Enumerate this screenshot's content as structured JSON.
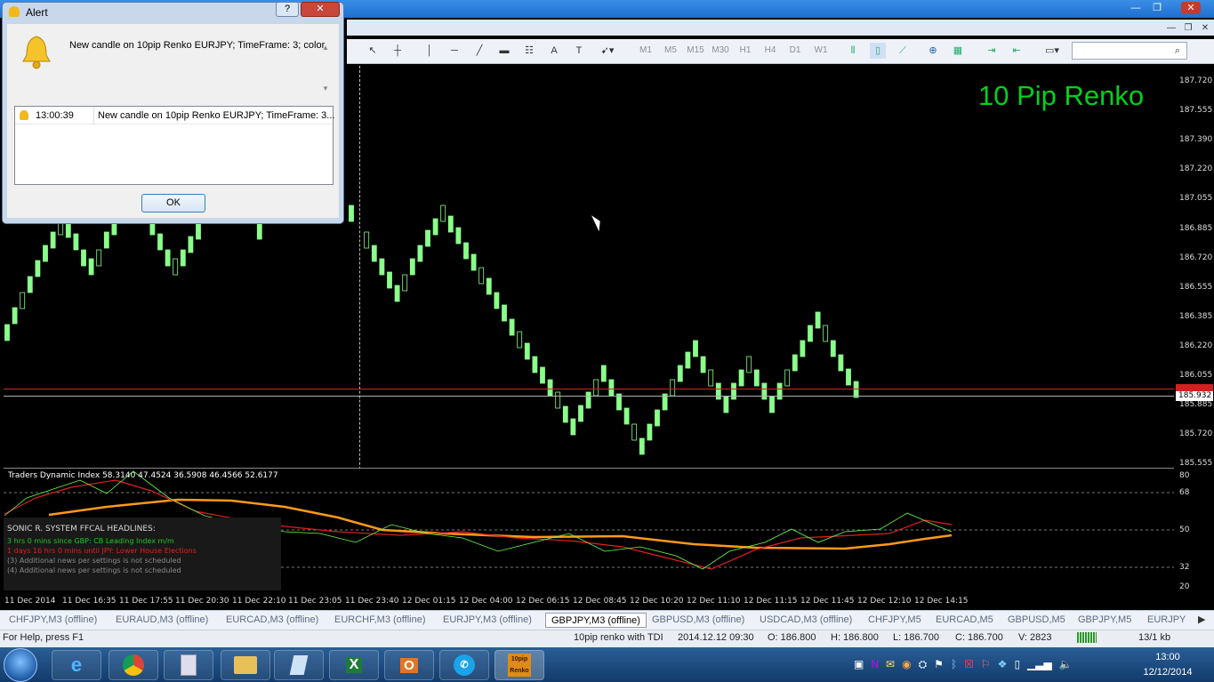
{
  "window": {
    "minimize": "—",
    "restore": "❐",
    "close": "✕"
  },
  "mdi": {
    "minimize": "—",
    "restore": "❐",
    "close": "✕"
  },
  "toolbar": {
    "timeframes": [
      "M1",
      "M5",
      "M15",
      "M30",
      "H1",
      "H4",
      "D1",
      "W1"
    ],
    "search_value": ""
  },
  "dialog": {
    "title": "Alert",
    "help_label": "?",
    "close_label": "✕",
    "message": "New candle on 10pip Renko EURJPY; TimeFrame: 3; color",
    "list": [
      {
        "time": "13:00:39",
        "text": "New candle on 10pip Renko EURJPY; TimeFrame: 3..."
      }
    ],
    "ok_label": "OK"
  },
  "chart": {
    "label": "10 Pip Renko",
    "price_labels": [
      "187.720",
      "187.555",
      "187.390",
      "187.220",
      "187.055",
      "186.885",
      "186.720",
      "186.555",
      "186.385",
      "186.220",
      "186.055",
      "185.885",
      "185.720",
      "185.555"
    ],
    "current_price": "185.932",
    "time_labels": [
      "11 Dec 2014",
      "11 Dec 16:35",
      "11 Dec 17:55",
      "11 Dec 20:30",
      "11 Dec 22:10",
      "11 Dec 23:05",
      "11 Dec 23:40",
      "12 Dec 01:15",
      "12 Dec 04:00",
      "12 Dec 06:15",
      "12 Dec 08:45",
      "12 Dec 10:20",
      "12 Dec 11:10",
      "12 Dec 11:15",
      "12 Dec 11:45",
      "12 Dec 12:10",
      "12 Dec 14:15"
    ],
    "bull_color": "#8aff8a"
  },
  "indicator": {
    "title": "Traders Dynamic Index 58.3140 47.4524 36.5908 46.4566 52.6177",
    "levels": [
      "80",
      "68",
      "50",
      "32",
      "20"
    ]
  },
  "news": {
    "header": "SONIC R. SYSTEM  FFCAL HEADLINES:",
    "lines": [
      {
        "text": "3 hrs 0 mins since GBP: CB Leading Index m/m",
        "color": "#22c422"
      },
      {
        "text": "1 days 16 hrs 0 mins until JPY: Lower House Elections",
        "color": "#e02020"
      },
      {
        "text": "(3)  Additional news per settings is not scheduled",
        "color": "#8a8a8a"
      },
      {
        "text": "(4)  Additional news per settings is not scheduled",
        "color": "#8a8a8a"
      }
    ]
  },
  "tabs": [
    "CHFJPY,M3 (offline)",
    "EURAUD,M3 (offline)",
    "EURCAD,M3 (offline)",
    "EURCHF,M3 (offline)",
    "EURJPY,M3 (offline)",
    "GBPJPY,M3 (offline)",
    "GBPUSD,M3 (offline)",
    "USDCAD,M3 (offline)",
    "CHFJPY,M5",
    "EURCAD,M5",
    "GBPUSD,M5",
    "GBPJPY,M5",
    "EURJPY"
  ],
  "active_tab": "GBPJPY,M3 (offline)",
  "status": {
    "help": "For Help, press F1",
    "profile": "10pip renko with TDI",
    "datetime": "2014.12.12 09:30",
    "open": "O: 186.800",
    "high": "H: 186.800",
    "low": "L: 186.700",
    "close": "C: 186.700",
    "volume": "V: 2823",
    "traffic": "13/1 kb"
  },
  "taskbar": {
    "apps": [
      "internet-explorer-icon",
      "chrome-icon",
      "calculator-icon",
      "file-explorer-icon",
      "notepad-icon",
      "excel-icon",
      "outlook-icon",
      "skype-icon",
      "renko-app-icon"
    ],
    "renko_app_label": "10pip Renko",
    "time": "13:00",
    "date": "12/12/2014"
  }
}
